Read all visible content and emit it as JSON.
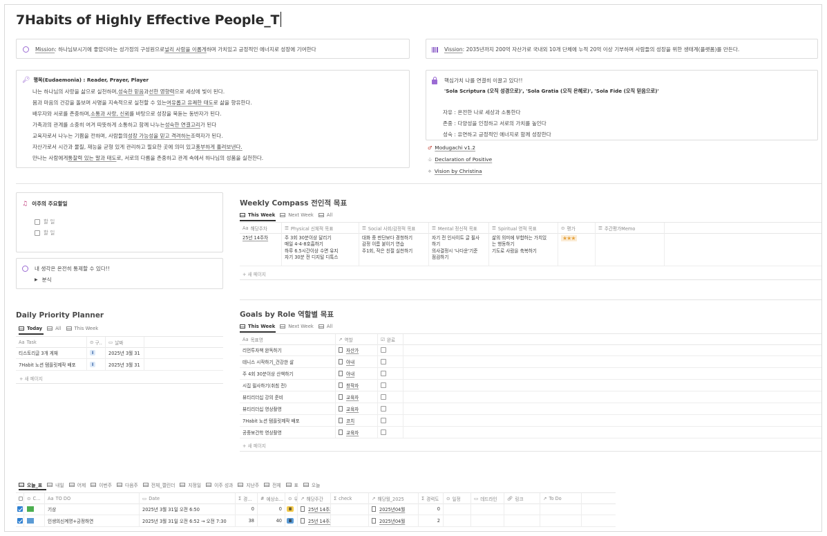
{
  "title": "7Habits of Highly Effective People_T",
  "mission": {
    "label": "Mission",
    "text_pre": " : 하나님보시기에 좋았더라는 성가정의 구성원으로 ",
    "text_link": "널리 사람을 이롭게",
    "text_post": " 하며 가치있고 긍정적인 에너지로 성장에 기여한다"
  },
  "vision": {
    "label": "Vission",
    "text": " : 2035년까지 200억 자산가로 국내외 10개 단체에 누적 20억 이상 기부하며 사람들의 성장을 위한 생태계(플랫폼)를 만든다."
  },
  "happiness": {
    "heading": "행복(Eudaemonia) : Reader,  Prayer, Player",
    "lines": [
      "나는 하나님의 사랑을 삶으로 실천하며, 성숙한 믿음과 선한 영향력으로 세상에 빛이 된다.",
      "몸과 마음의 건강을 돌보며 사명을 지속적으로 실천할 수 있는 여유롭고 유쾌한 태도로 삶을 향유한다.",
      "배우자와 서로를 존중하며, 소통과 사랑, 신뢰를 바탕으로 성장을 북돋는 동반자가 된다.",
      "가족과의 관계를 소중히 여겨 따뜻하게 소통하고 함께 나누는 성숙한 연결고리가 된다.",
      "교육자로서 나누는 기쁨을 전하며, 사람들의 성장 가능성을  믿고 격려하는 조력자가 된다.",
      "자산가로서 시간과 물질, 재능을 균형 있게 관리하고 필요한 곳에 의미 있고 풍부하게 흘려보낸다.",
      "만나는 사람에게 통찰력 있는 말과 태도로, 서로의 다름을 존중하고 관계 속에서 하나님의 성품을 실천한다."
    ]
  },
  "core_values": {
    "intro": "핵심가치 나를 연결히 이끌고 있다!!",
    "solas": "'Sola Scriptura (오직 성경으로)', 'Sola Gratia (오직 은혜로)', 'Sola Fide (오직 믿음으로)'",
    "items": [
      "자유 : 온전한 나로 세상과 소통한다",
      "존중 : 다양성을 인정하고 서로의 가치를 높인다",
      "성숙 : 유연하고 긍정적인 에너지로 함께 성장한다"
    ]
  },
  "links": [
    {
      "icon": "♂",
      "label": "Modugachi  v1.2"
    },
    {
      "icon": "♧",
      "label": "Declaration of Positive"
    },
    {
      "icon": "✧",
      "label": "Vision by Christina "
    }
  ],
  "weekly_tasks": {
    "title": "이주의 주요할일",
    "items": [
      "할 일",
      "할 일"
    ]
  },
  "thought": {
    "text": "내 생각은 온전히 통제할 수 있다!!",
    "toggle": "분식"
  },
  "weekly_compass": {
    "title": "Weekly Compass 전인적 목표",
    "tabs": [
      "This Week",
      "Next Week",
      "All"
    ],
    "columns": [
      "해당주차",
      "Physical 신체적 목표",
      "Social 사회/감정적 목표",
      "Mental 정신적 목표",
      "Spiritual 영적 목표",
      "평가",
      "주간평가Memo"
    ],
    "row": {
      "week": "25년 14주차",
      "physical": [
        "주 3회 30분이상 달리기",
        "매일 4-4-8호흡하기",
        "하루 6.5시간이상 수면 유지",
        "자기 30분 전 디지털 디톡스"
      ],
      "social": [
        "대화 중 판단보다 경청하기",
        "감정 이름 붙이기 연습",
        "주1회, 작은 친절 실천하기"
      ],
      "mental": [
        "자기 전 인사이트 글 필사",
        "하기",
        "의사결정시 '나다운'기준",
        "점검하기"
      ],
      "spiritual": [
        "삶의 의미에 부합하는 가치있",
        "는 행동하기",
        "기도로 사람을 축복하기"
      ],
      "rating": "★★★"
    },
    "new_page": "+ 새 페이지"
  },
  "daily_planner": {
    "title": "Daily Priority Planner",
    "tabs": [
      "Today",
      "All",
      "This Week"
    ],
    "columns": [
      "Task",
      "구..",
      "날짜"
    ],
    "rows": [
      {
        "task": "티스토리글 3개 게재",
        "tag": "Ⅰ",
        "date": "2025년 3월 31"
      },
      {
        "task": "7Habit 노션 템플릿제작 배포",
        "tag": "Ⅰ",
        "date": "2025년 3월 31"
      }
    ],
    "new_page": "+ 새 페이지"
  },
  "goals_by_role": {
    "title": "Goals by Role 역할별 목표",
    "tabs": [
      "This Week",
      "Next Week",
      "All"
    ],
    "columns": [
      "목표명",
      "역할",
      "완료"
    ],
    "rows": [
      {
        "goal": "리먼투자책 완독하기",
        "role": "자산가"
      },
      {
        "goal": "테니스 시작하기_건강한 삶",
        "role": "아내"
      },
      {
        "goal": "주 4회 30분이상 산책하기",
        "role": "아내"
      },
      {
        "goal": "시집 필사하기(취침 전)",
        "role": "창작자"
      },
      {
        "goal": "뷰티리더십 강의 준비",
        "role": "교육자"
      },
      {
        "goal": "뷰티리더십 영상촬영",
        "role": "교육자"
      },
      {
        "goal": "7Habit 노션 템플릿제작 배포",
        "role": "코치"
      },
      {
        "goal": "공중보건학 영상촬영",
        "role": "교육자"
      }
    ],
    "new_page": "+ 새 페이지"
  },
  "bottom": {
    "tabs": [
      "오늘_표",
      "내일",
      "어제",
      "이번주",
      "다음주",
      "전체_캘린더",
      "지정일",
      "이주 성과",
      "지난주",
      "전체",
      "표",
      "오늘"
    ],
    "columns": [
      "C...",
      "TO DO",
      "Date",
      "경...",
      "예상소...",
      "우",
      "해당주간",
      "check",
      "해당월_2025",
      "경력도",
      "일정",
      "데드라인",
      "링크",
      "To Do"
    ],
    "rows": [
      {
        "color": "#4caf50",
        "todo": "기상",
        "date": "2025년 3월 31일 오전 6:50",
        "a": "0",
        "b": "0",
        "pr": "Ⅱ",
        "prColor": "#f2c94c",
        "week": "25년 14주차",
        "month": "2025년04월",
        "level": "0"
      },
      {
        "color": "#5b9bd5",
        "todo": "인생의신계명+긍정하연",
        "date": "2025년 3월 31일 오전 6:52 → 오전 7:30",
        "a": "38",
        "b": "40",
        "pr": "Ⅱ",
        "prColor": "#5b9bd5",
        "week": "25년 14주차",
        "month": "2025년04월",
        "level": "2"
      }
    ]
  },
  "colors": {
    "accent": "#9b6bd3",
    "check_blue": "#2f80d1",
    "star": "#e6a23c"
  }
}
